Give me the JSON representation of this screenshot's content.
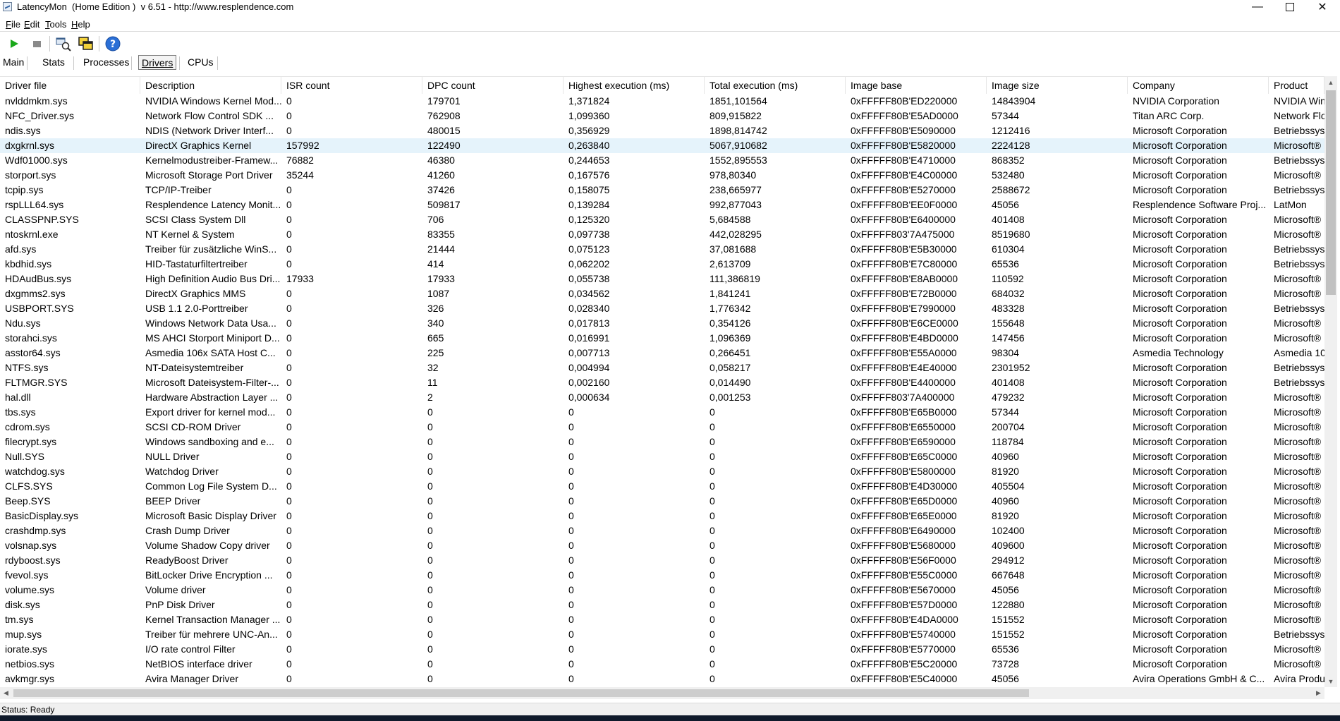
{
  "window": {
    "title": "LatencyMon  (Home Edition )  v 6.51 - http://www.resplendence.com",
    "minimize_glyph": "—",
    "close_glyph": "✕"
  },
  "menu": [
    {
      "label": "File",
      "accel": "F",
      "rest": "ile"
    },
    {
      "label": "Edit",
      "accel": "E",
      "rest": "dit"
    },
    {
      "label": "Tools",
      "accel": "T",
      "rest": "ools"
    },
    {
      "label": "Help",
      "accel": "H",
      "rest": "elp"
    }
  ],
  "toolbar": {
    "icons": [
      "play-icon",
      "stop-icon",
      "find-process-icon",
      "windows-icon",
      "help-icon"
    ],
    "colors": {
      "play": "#1aa81a",
      "stop": "#808080",
      "help": "#2a6fd6"
    }
  },
  "tabs": [
    {
      "label": "Main",
      "active": false
    },
    {
      "label": "Stats",
      "active": false
    },
    {
      "label": "Processes",
      "active": false
    },
    {
      "label": "Drivers",
      "active": true
    },
    {
      "label": "CPUs",
      "active": false
    }
  ],
  "table": {
    "columns": [
      "Driver file",
      "Description",
      "ISR count",
      "DPC count",
      "Highest execution (ms)",
      "Total execution (ms)",
      "Image base",
      "Image size",
      "Company",
      "Product"
    ],
    "selected_row": 3,
    "selection_color": "#e5f3fb",
    "rows": [
      [
        "nvlddmkm.sys",
        "NVIDIA Windows Kernel Mod...",
        "0",
        "179701",
        "1,371824",
        "1851,101564",
        "0xFFFFF80B'ED220000",
        "14843904",
        "NVIDIA Corporation",
        "NVIDIA Win"
      ],
      [
        "NFC_Driver.sys",
        "Network Flow Control SDK ...",
        "0",
        "762908",
        "1,099360",
        "809,915822",
        "0xFFFFF80B'E5AD0000",
        "57344",
        "Titan ARC Corp.",
        "Network Flo"
      ],
      [
        "ndis.sys",
        "NDIS (Network Driver Interf...",
        "0",
        "480015",
        "0,356929",
        "1898,814742",
        "0xFFFFF80B'E5090000",
        "1212416",
        "Microsoft Corporation",
        "Betriebssys"
      ],
      [
        "dxgkrnl.sys",
        "DirectX Graphics Kernel",
        "157992",
        "122490",
        "0,263840",
        "5067,910682",
        "0xFFFFF80B'E5820000",
        "2224128",
        "Microsoft Corporation",
        "Microsoft®"
      ],
      [
        "Wdf01000.sys",
        "Kernelmodustreiber-Framew...",
        "76882",
        "46380",
        "0,244653",
        "1552,895553",
        "0xFFFFF80B'E4710000",
        "868352",
        "Microsoft Corporation",
        "Betriebssys"
      ],
      [
        "storport.sys",
        "Microsoft Storage Port Driver",
        "35244",
        "41260",
        "0,167576",
        "978,80340",
        "0xFFFFF80B'E4C00000",
        "532480",
        "Microsoft Corporation",
        "Microsoft®"
      ],
      [
        "tcpip.sys",
        "TCP/IP-Treiber",
        "0",
        "37426",
        "0,158075",
        "238,665977",
        "0xFFFFF80B'E5270000",
        "2588672",
        "Microsoft Corporation",
        "Betriebssys"
      ],
      [
        "rspLLL64.sys",
        "Resplendence Latency Monit...",
        "0",
        "509817",
        "0,139284",
        "992,877043",
        "0xFFFFF80B'EE0F0000",
        "45056",
        "Resplendence Software Proj...",
        "LatMon"
      ],
      [
        "CLASSPNP.SYS",
        "SCSI Class System Dll",
        "0",
        "706",
        "0,125320",
        "5,684588",
        "0xFFFFF80B'E6400000",
        "401408",
        "Microsoft Corporation",
        "Microsoft®"
      ],
      [
        "ntoskrnl.exe",
        "NT Kernel & System",
        "0",
        "83355",
        "0,097738",
        "442,028295",
        "0xFFFFF803'7A475000",
        "8519680",
        "Microsoft Corporation",
        "Microsoft®"
      ],
      [
        "afd.sys",
        "Treiber für zusätzliche WinS...",
        "0",
        "21444",
        "0,075123",
        "37,081688",
        "0xFFFFF80B'E5B30000",
        "610304",
        "Microsoft Corporation",
        "Betriebssys"
      ],
      [
        "kbdhid.sys",
        "HID-Tastaturfiltertreiber",
        "0",
        "414",
        "0,062202",
        "2,613709",
        "0xFFFFF80B'E7C80000",
        "65536",
        "Microsoft Corporation",
        "Betriebssys"
      ],
      [
        "HDAudBus.sys",
        "High Definition Audio Bus Dri...",
        "17933",
        "17933",
        "0,055738",
        "111,386819",
        "0xFFFFF80B'E8AB0000",
        "110592",
        "Microsoft Corporation",
        "Microsoft®"
      ],
      [
        "dxgmms2.sys",
        "DirectX Graphics MMS",
        "0",
        "1087",
        "0,034562",
        "1,841241",
        "0xFFFFF80B'E72B0000",
        "684032",
        "Microsoft Corporation",
        "Microsoft®"
      ],
      [
        "USBPORT.SYS",
        "USB 1.1  2.0-Porttreiber",
        "0",
        "326",
        "0,028340",
        "1,776342",
        "0xFFFFF80B'E7990000",
        "483328",
        "Microsoft Corporation",
        "Betriebssys"
      ],
      [
        "Ndu.sys",
        "Windows Network Data Usa...",
        "0",
        "340",
        "0,017813",
        "0,354126",
        "0xFFFFF80B'E6CE0000",
        "155648",
        "Microsoft Corporation",
        "Microsoft®"
      ],
      [
        "storahci.sys",
        "MS AHCI Storport Miniport D...",
        "0",
        "665",
        "0,016991",
        "1,096369",
        "0xFFFFF80B'E4BD0000",
        "147456",
        "Microsoft Corporation",
        "Microsoft®"
      ],
      [
        "asstor64.sys",
        "Asmedia 106x SATA Host C...",
        "0",
        "225",
        "0,007713",
        "0,266451",
        "0xFFFFF80B'E55A0000",
        "98304",
        "Asmedia Technology",
        "Asmedia 10"
      ],
      [
        "NTFS.sys",
        "NT-Dateisystemtreiber",
        "0",
        "32",
        "0,004994",
        "0,058217",
        "0xFFFFF80B'E4E40000",
        "2301952",
        "Microsoft Corporation",
        "Betriebssys"
      ],
      [
        "FLTMGR.SYS",
        "Microsoft Dateisystem-Filter-...",
        "0",
        "11",
        "0,002160",
        "0,014490",
        "0xFFFFF80B'E4400000",
        "401408",
        "Microsoft Corporation",
        "Betriebssys"
      ],
      [
        "hal.dll",
        "Hardware Abstraction Layer ...",
        "0",
        "2",
        "0,000634",
        "0,001253",
        "0xFFFFF803'7A400000",
        "479232",
        "Microsoft Corporation",
        "Microsoft®"
      ],
      [
        "tbs.sys",
        "Export driver for kernel mod...",
        "0",
        "0",
        "0",
        "0",
        "0xFFFFF80B'E65B0000",
        "57344",
        "Microsoft Corporation",
        "Microsoft®"
      ],
      [
        "cdrom.sys",
        "SCSI CD-ROM Driver",
        "0",
        "0",
        "0",
        "0",
        "0xFFFFF80B'E6550000",
        "200704",
        "Microsoft Corporation",
        "Microsoft®"
      ],
      [
        "filecrypt.sys",
        "Windows sandboxing and e...",
        "0",
        "0",
        "0",
        "0",
        "0xFFFFF80B'E6590000",
        "118784",
        "Microsoft Corporation",
        "Microsoft®"
      ],
      [
        "Null.SYS",
        "NULL Driver",
        "0",
        "0",
        "0",
        "0",
        "0xFFFFF80B'E65C0000",
        "40960",
        "Microsoft Corporation",
        "Microsoft®"
      ],
      [
        "watchdog.sys",
        "Watchdog Driver",
        "0",
        "0",
        "0",
        "0",
        "0xFFFFF80B'E5800000",
        "81920",
        "Microsoft Corporation",
        "Microsoft®"
      ],
      [
        "CLFS.SYS",
        "Common Log File System D...",
        "0",
        "0",
        "0",
        "0",
        "0xFFFFF80B'E4D30000",
        "405504",
        "Microsoft Corporation",
        "Microsoft®"
      ],
      [
        "Beep.SYS",
        "BEEP Driver",
        "0",
        "0",
        "0",
        "0",
        "0xFFFFF80B'E65D0000",
        "40960",
        "Microsoft Corporation",
        "Microsoft®"
      ],
      [
        "BasicDisplay.sys",
        "Microsoft Basic Display Driver",
        "0",
        "0",
        "0",
        "0",
        "0xFFFFF80B'E65E0000",
        "81920",
        "Microsoft Corporation",
        "Microsoft®"
      ],
      [
        "crashdmp.sys",
        "Crash Dump Driver",
        "0",
        "0",
        "0",
        "0",
        "0xFFFFF80B'E6490000",
        "102400",
        "Microsoft Corporation",
        "Microsoft®"
      ],
      [
        "volsnap.sys",
        "Volume Shadow Copy driver",
        "0",
        "0",
        "0",
        "0",
        "0xFFFFF80B'E5680000",
        "409600",
        "Microsoft Corporation",
        "Microsoft®"
      ],
      [
        "rdyboost.sys",
        "ReadyBoost Driver",
        "0",
        "0",
        "0",
        "0",
        "0xFFFFF80B'E56F0000",
        "294912",
        "Microsoft Corporation",
        "Microsoft®"
      ],
      [
        "fvevol.sys",
        "BitLocker Drive Encryption ...",
        "0",
        "0",
        "0",
        "0",
        "0xFFFFF80B'E55C0000",
        "667648",
        "Microsoft Corporation",
        "Microsoft®"
      ],
      [
        "volume.sys",
        "Volume driver",
        "0",
        "0",
        "0",
        "0",
        "0xFFFFF80B'E5670000",
        "45056",
        "Microsoft Corporation",
        "Microsoft®"
      ],
      [
        "disk.sys",
        "PnP Disk Driver",
        "0",
        "0",
        "0",
        "0",
        "0xFFFFF80B'E57D0000",
        "122880",
        "Microsoft Corporation",
        "Microsoft®"
      ],
      [
        "tm.sys",
        "Kernel Transaction Manager ...",
        "0",
        "0",
        "0",
        "0",
        "0xFFFFF80B'E4DA0000",
        "151552",
        "Microsoft Corporation",
        "Microsoft®"
      ],
      [
        "mup.sys",
        "Treiber für mehrere UNC-An...",
        "0",
        "0",
        "0",
        "0",
        "0xFFFFF80B'E5740000",
        "151552",
        "Microsoft Corporation",
        "Betriebssys"
      ],
      [
        "iorate.sys",
        "I/O rate control Filter",
        "0",
        "0",
        "0",
        "0",
        "0xFFFFF80B'E5770000",
        "65536",
        "Microsoft Corporation",
        "Microsoft®"
      ],
      [
        "netbios.sys",
        "NetBIOS interface driver",
        "0",
        "0",
        "0",
        "0",
        "0xFFFFF80B'E5C20000",
        "73728",
        "Microsoft Corporation",
        "Microsoft®"
      ],
      [
        "avkmgr.sys",
        "Avira Manager Driver",
        "0",
        "0",
        "0",
        "0",
        "0xFFFFF80B'E5C40000",
        "45056",
        "Avira Operations GmbH & C...",
        "Avira Produ"
      ]
    ]
  },
  "status": "Status: Ready"
}
